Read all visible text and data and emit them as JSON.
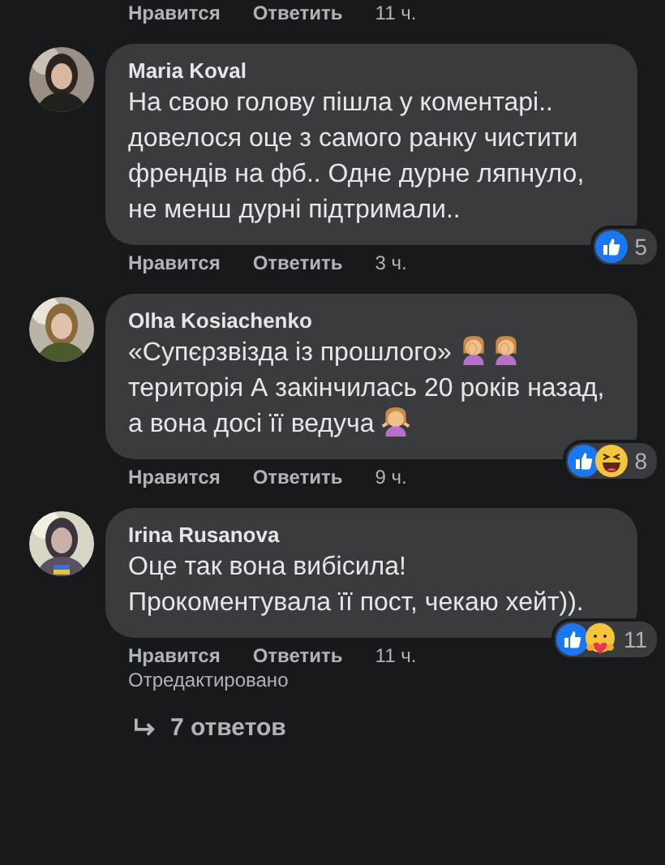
{
  "top_actions": {
    "like": "Нравится",
    "reply": "Ответить",
    "time": "11 ч."
  },
  "comments": [
    {
      "author": "Maria Koval",
      "parts": [
        {
          "kind": "text",
          "text": "На свою голову пішла у коментарі.. довелося оце з самого ранку чистити френдів на фб.. Одне дурне ляпнуло, не менш дурні підтримали.."
        }
      ],
      "reactions": [
        {
          "kind": "like"
        }
      ],
      "count": "5",
      "like": "Нравится",
      "reply": "Ответить",
      "time": "3 ч."
    },
    {
      "author": "Olha Kosiachenko",
      "parts": [
        {
          "kind": "text",
          "text": "«Супєрзвізда із прошлого»"
        },
        {
          "kind": "facepalm"
        },
        {
          "kind": "facepalm"
        },
        {
          "kind": "text",
          "text": "територія А закінчилась 20 років назад, а вона досі її ведуча"
        },
        {
          "kind": "shrug"
        }
      ],
      "reactions": [
        {
          "kind": "like"
        },
        {
          "kind": "haha"
        }
      ],
      "count": "8",
      "like": "Нравится",
      "reply": "Ответить",
      "time": "9 ч."
    },
    {
      "author": "Irina Rusanova",
      "parts": [
        {
          "kind": "text",
          "text": "Оце так вона вибісила! Прокоментувала її пост, чекаю хейт))."
        }
      ],
      "reactions": [
        {
          "kind": "like"
        },
        {
          "kind": "care"
        }
      ],
      "count": "11",
      "like": "Нравится",
      "reply": "Ответить",
      "time": "11 ч.",
      "edited": "Отредактировано"
    }
  ],
  "replies_link": "7 ответов"
}
